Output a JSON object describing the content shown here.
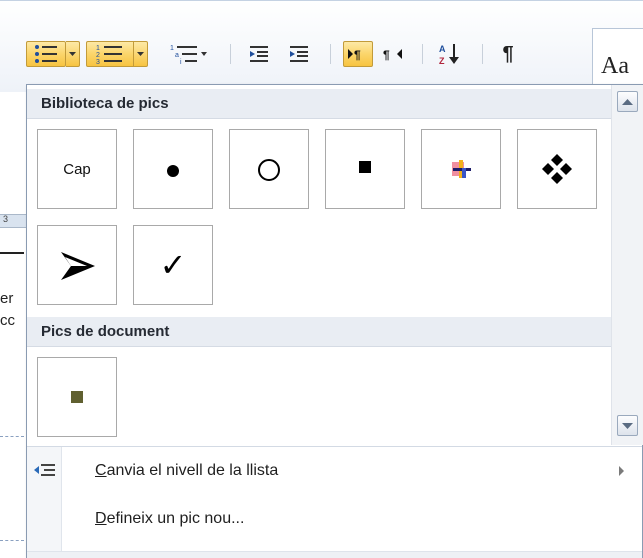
{
  "styles_preview": "Aa",
  "ruler_number": "3",
  "doc_fragments": [
    "er",
    "cc"
  ],
  "menu": {
    "sections": [
      {
        "title": "Biblioteca de pics"
      },
      {
        "title": "Pics de document"
      }
    ],
    "library_bullets": [
      {
        "label": "Cap",
        "icon": "none-text"
      },
      {
        "icon": "filled-circle-bullet-icon"
      },
      {
        "icon": "hollow-circle-bullet-icon"
      },
      {
        "icon": "filled-square-bullet-icon"
      },
      {
        "icon": "colored-cross-bullet-icon"
      },
      {
        "icon": "four-diamonds-bullet-icon"
      },
      {
        "icon": "arrowhead-bullet-icon"
      },
      {
        "icon": "checkmark-bullet-icon"
      }
    ],
    "document_bullets": [
      {
        "icon": "olive-square-bullet-icon",
        "color": "#606030"
      }
    ],
    "items": [
      {
        "accel": "C",
        "rest": "anvia el nivell de la llista",
        "has_submenu": true
      },
      {
        "accel": "D",
        "rest": "efineix un pic nou...",
        "has_submenu": false
      }
    ]
  },
  "colors": {
    "active_button": "#f7c441",
    "section_header_bg": "#e9edf3",
    "menu_border": "#8a9bb2"
  }
}
